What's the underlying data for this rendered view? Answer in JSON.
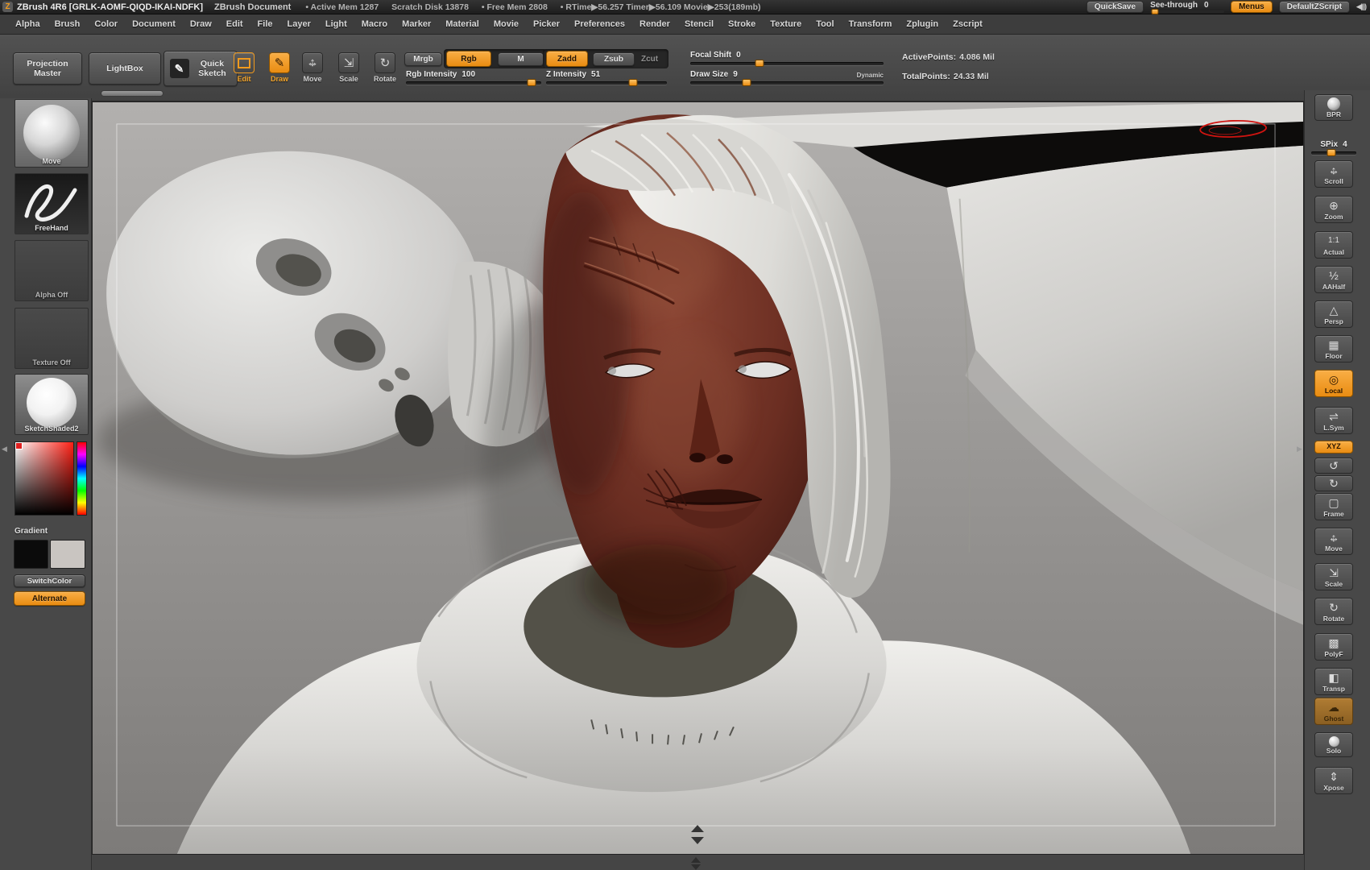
{
  "colors": {
    "accent_orange": "#ef9b21",
    "annotation_red": "#d01410"
  },
  "icons": {
    "logo": "Z",
    "dropdown": "▾",
    "volume": "◀)))",
    "pencil": "✎",
    "magnifier": "⊕",
    "actual": "1:1",
    "half": "½",
    "persp": "△",
    "floor": "▦",
    "local": "◎",
    "lsym": "⇌",
    "frame": "▢",
    "scale": "⇲",
    "rotate": "↻",
    "rotate_ccw": "↺",
    "polyframe": "▩",
    "transp": "◧",
    "ghost": "☁",
    "solo": "●",
    "xpose": "⇕"
  },
  "titlebar": {
    "app_title": "ZBrush 4R6 [GRLK-AOMF-QIQD-IKAI-NDFK]",
    "doc_title": "ZBrush Document",
    "stats": {
      "active_mem": "• Active Mem 1287",
      "scratch_disk": "Scratch Disk 13878",
      "free_mem": "• Free Mem 2808",
      "timers": "• RTime▶56.257 Timer▶56.109 Movie▶253(189mb)"
    },
    "quicksave_label": "QuickSave",
    "see_through_label": "See-through",
    "see_through_value": "0",
    "menus_label": "Menus",
    "default_zscript_label": "DefaultZScript"
  },
  "menubar": {
    "items": [
      "Alpha",
      "Brush",
      "Color",
      "Document",
      "Draw",
      "Edit",
      "File",
      "Layer",
      "Light",
      "Macro",
      "Marker",
      "Material",
      "Movie",
      "Picker",
      "Preferences",
      "Render",
      "Stencil",
      "Stroke",
      "Texture",
      "Tool",
      "Transform",
      "Zplugin",
      "Zscript"
    ]
  },
  "toolbar": {
    "projection_master": "Projection Master",
    "lightbox": "LightBox",
    "quick_sketch": "Quick Sketch",
    "edit_label": "Edit",
    "draw_label": "Draw",
    "move_label": "Move",
    "scale_label": "Scale",
    "rotate_label": "Rotate",
    "mrgb_label": "Mrgb",
    "rgb_label": "Rgb",
    "m_label": "M",
    "zadd_label": "Zadd",
    "zsub_label": "Zsub",
    "zcut_label": "Zcut",
    "rgb_intensity_label": "Rgb Intensity",
    "rgb_intensity_value": "100",
    "z_intensity_label": "Z Intensity",
    "z_intensity_value": "51",
    "focal_shift_label": "Focal Shift",
    "focal_shift_value": "0",
    "draw_size_label": "Draw Size",
    "draw_size_value": "9",
    "dynamic_label": "Dynamic",
    "active_points_label": "ActivePoints:",
    "active_points_value": "4.086 Mil",
    "total_points_label": "TotalPoints:",
    "total_points_value": "24.33 Mil"
  },
  "left_panel": {
    "brush_label": "Move",
    "stroke_label": "FreeHand",
    "alpha_label": "Alpha Off",
    "texture_label": "Texture Off",
    "material_label": "SketchShaded2",
    "gradient_label": "Gradient",
    "switch_color_label": "SwitchColor",
    "alternate_label": "Alternate"
  },
  "right_panel": {
    "bpr_label": "BPR",
    "spix_label": "SPix",
    "spix_value": "4",
    "buttons": [
      {
        "label": "Scroll"
      },
      {
        "label": "Zoom"
      },
      {
        "label": "Actual"
      },
      {
        "label": "AAHalf"
      },
      {
        "label": "Persp"
      },
      {
        "label": "Floor"
      },
      {
        "label": "Local"
      },
      {
        "label": "L.Sym"
      },
      {
        "label": "XYZ"
      },
      {
        "label": "Frame"
      },
      {
        "label": "Move"
      },
      {
        "label": "Scale"
      },
      {
        "label": "Rotate"
      },
      {
        "label": "PolyF"
      },
      {
        "label": "Transp"
      },
      {
        "label": "Ghost"
      },
      {
        "label": "Solo"
      },
      {
        "label": "Xpose"
      }
    ]
  }
}
